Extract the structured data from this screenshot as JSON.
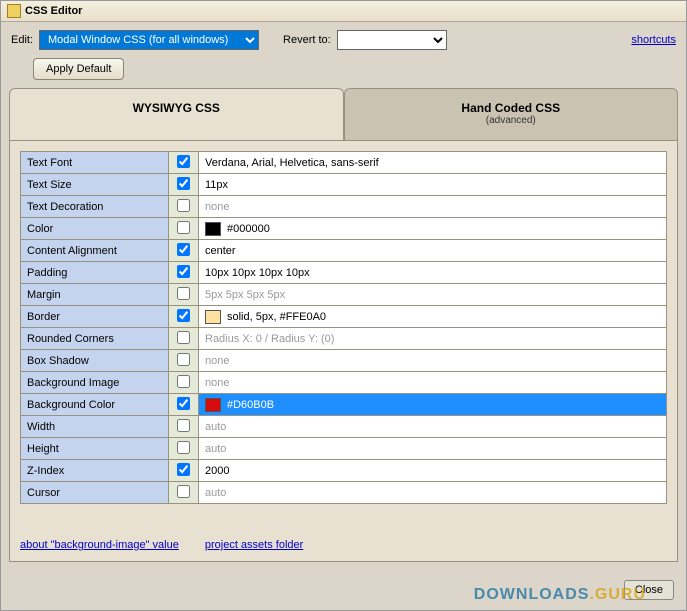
{
  "title": "CSS Editor",
  "toolbar": {
    "edit_label": "Edit:",
    "edit_value": "Modal Window CSS (for all windows)",
    "revert_label": "Revert to:",
    "revert_value": "",
    "shortcuts": "shortcuts",
    "apply_default": "Apply Default"
  },
  "tabs": {
    "wysiwyg": "WYSIWYG CSS",
    "handcoded": "Hand Coded CSS",
    "handcoded_sub": "(advanced)"
  },
  "props": [
    {
      "label": "Text Font",
      "checked": true,
      "value": "Verdana, Arial, Helvetica, sans-serif",
      "enabled": true
    },
    {
      "label": "Text Size",
      "checked": true,
      "value": "11px",
      "enabled": true
    },
    {
      "label": "Text Decoration",
      "checked": false,
      "value": "none",
      "enabled": false
    },
    {
      "label": "Color",
      "checked": false,
      "value": "#000000",
      "enabled": true,
      "swatch": "#000000"
    },
    {
      "label": "Content Alignment",
      "checked": true,
      "value": "center",
      "enabled": true
    },
    {
      "label": "Padding",
      "checked": true,
      "value": "10px 10px 10px 10px",
      "enabled": true
    },
    {
      "label": "Margin",
      "checked": false,
      "value": "5px 5px 5px 5px",
      "enabled": false
    },
    {
      "label": "Border",
      "checked": true,
      "value": "solid, 5px, #FFE0A0",
      "enabled": true,
      "swatch": "#FFE0A0"
    },
    {
      "label": "Rounded Corners",
      "checked": false,
      "value": "Radius X: 0  /  Radius Y: (0)",
      "enabled": false
    },
    {
      "label": "Box Shadow",
      "checked": false,
      "value": "none",
      "enabled": false
    },
    {
      "label": "Background Image",
      "checked": false,
      "value": "none",
      "enabled": false
    },
    {
      "label": "Background Color",
      "checked": true,
      "value": "#D60B0B",
      "enabled": true,
      "swatch": "#D60B0B",
      "selected": true
    },
    {
      "label": "Width",
      "checked": false,
      "value": "auto",
      "enabled": false
    },
    {
      "label": "Height",
      "checked": false,
      "value": "auto",
      "enabled": false
    },
    {
      "label": "Z-Index",
      "checked": true,
      "value": "2000",
      "enabled": true
    },
    {
      "label": "Cursor",
      "checked": false,
      "value": "auto",
      "enabled": false
    }
  ],
  "footer": {
    "about_bg": "about \"background-image\" value",
    "assets": "project assets folder"
  },
  "close": "Close",
  "watermark": {
    "a": "DOWNLOADS",
    "b": ".GURU"
  }
}
